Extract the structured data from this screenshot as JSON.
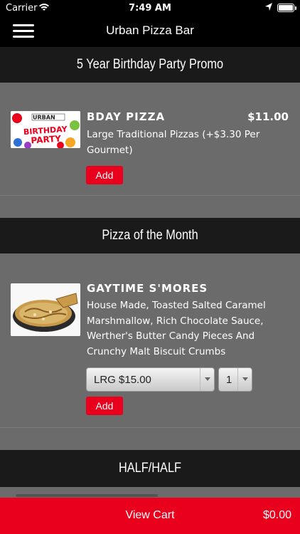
{
  "status_bar": {
    "carrier": "Carrier",
    "time": "7:49 AM"
  },
  "nav": {
    "title": "Urban Pizza Bar"
  },
  "sections": [
    {
      "title": "5 Year Birthday Party Promo",
      "items": [
        {
          "name": "BDAY PIZZA",
          "price": "$11.00",
          "description": "Large Traditional Pizzas (+$3.30 Per Gourmet)",
          "image_text_top": "URBAN",
          "image_text_main": "BIRTHDAY PARTY",
          "add_label": "Add"
        }
      ]
    },
    {
      "title": "Pizza of the Month",
      "items": [
        {
          "name": "GAYTIME S'MORES",
          "description": "House Made, Toasted Salted Caramel Marshmallow, Rich Chocolate Sauce, Werther's Butter Candy Pieces And Crunchy Malt Biscuit Crumbs",
          "size_selected": "LRG $15.00",
          "qty_selected": "1",
          "add_label": "Add"
        }
      ]
    },
    {
      "title": "HALF/HALF"
    }
  ],
  "cart": {
    "label": "View Cart",
    "total": "$0.00"
  },
  "colors": {
    "accent": "#e8001c",
    "header_bg": "#1a1a1a",
    "content_bg": "#6b6b6b"
  },
  "icons": [
    "wifi-icon",
    "location-arrow-icon",
    "battery-icon",
    "hamburger-menu-icon",
    "dropdown-arrow-icon"
  ]
}
